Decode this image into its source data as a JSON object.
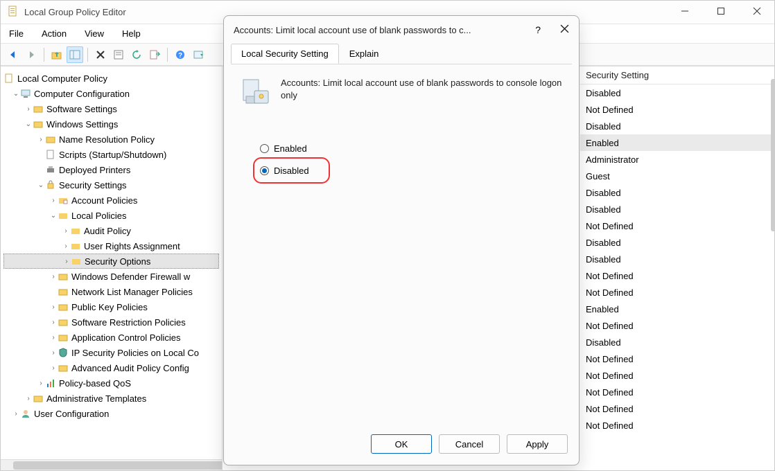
{
  "window": {
    "title": "Local Group Policy Editor"
  },
  "menus": [
    "File",
    "Action",
    "View",
    "Help"
  ],
  "tree": {
    "root": "Local Computer Policy",
    "computer_config": "Computer Configuration",
    "software_settings": "Software Settings",
    "windows_settings": "Windows Settings",
    "name_res": "Name Resolution Policy",
    "scripts": "Scripts (Startup/Shutdown)",
    "deployed_printers": "Deployed Printers",
    "security_settings": "Security Settings",
    "account_policies": "Account Policies",
    "local_policies": "Local Policies",
    "audit_policy": "Audit Policy",
    "user_rights": "User Rights Assignment",
    "security_options": "Security Options",
    "defender": "Windows Defender Firewall w",
    "network_list": "Network List Manager Policies",
    "public_key": "Public Key Policies",
    "software_restriction": "Software Restriction Policies",
    "app_control": "Application Control Policies",
    "ip_security": "IP Security Policies on Local Co",
    "adv_audit": "Advanced Audit Policy Config",
    "policy_qos": "Policy-based QoS",
    "admin_templates": "Administrative Templates",
    "user_config": "User Configuration"
  },
  "list": {
    "header": "Security Setting",
    "rows": [
      "Disabled",
      "Not Defined",
      "Disabled",
      "Enabled",
      "Administrator",
      "Guest",
      "Disabled",
      "Disabled",
      "Not Defined",
      "Disabled",
      "Disabled",
      "Not Defined",
      "Not Defined",
      "Enabled",
      "Not Defined",
      "Disabled",
      "Not Defined",
      "Not Defined",
      "Not Defined",
      "Not Defined",
      "Not Defined"
    ],
    "selected_index": 3
  },
  "dialog": {
    "title": "Accounts: Limit local account use of blank passwords to c...",
    "tabs": {
      "local": "Local Security Setting",
      "explain": "Explain"
    },
    "policy_text": "Accounts: Limit local account use of blank passwords to console logon only",
    "enabled_label": "Enabled",
    "disabled_label": "Disabled",
    "ok": "OK",
    "cancel": "Cancel",
    "apply": "Apply"
  }
}
